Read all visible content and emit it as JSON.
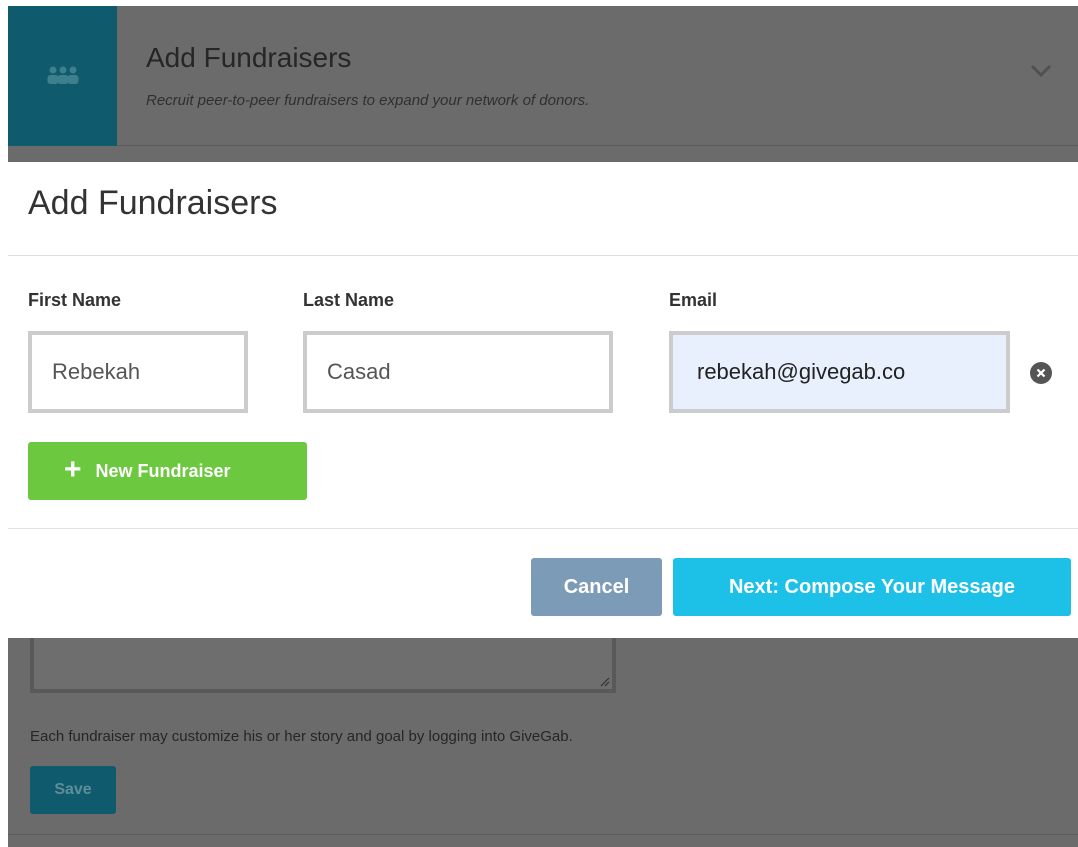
{
  "background": {
    "section": {
      "title": "Add Fundraisers",
      "description": "Recruit peer-to-peer fundraisers to expand your network of donors.",
      "icon": "users-group-icon",
      "chevron_icon": "chevron-down-icon"
    },
    "help_text": "Each fundraiser may customize his or her story and goal by logging into GiveGab.",
    "save_label": "Save"
  },
  "modal": {
    "title": "Add Fundraisers",
    "fields": {
      "first_name": {
        "label": "First Name",
        "value": "Rebekah"
      },
      "last_name": {
        "label": "Last Name",
        "value": "Casad"
      },
      "email": {
        "label": "Email",
        "value": "rebekah@givegab.co"
      }
    },
    "remove_icon": "close-circle-icon",
    "new_fundraiser_label": "New Fundraiser",
    "cancel_label": "Cancel",
    "next_label": "Next: Compose Your Message"
  },
  "colors": {
    "brand_teal": "#0f5a6c",
    "add_green": "#6cc93f",
    "next_blue": "#1dc1e8",
    "cancel_slate": "#7c9bb6",
    "autofill_bg": "#e8f0fe"
  }
}
